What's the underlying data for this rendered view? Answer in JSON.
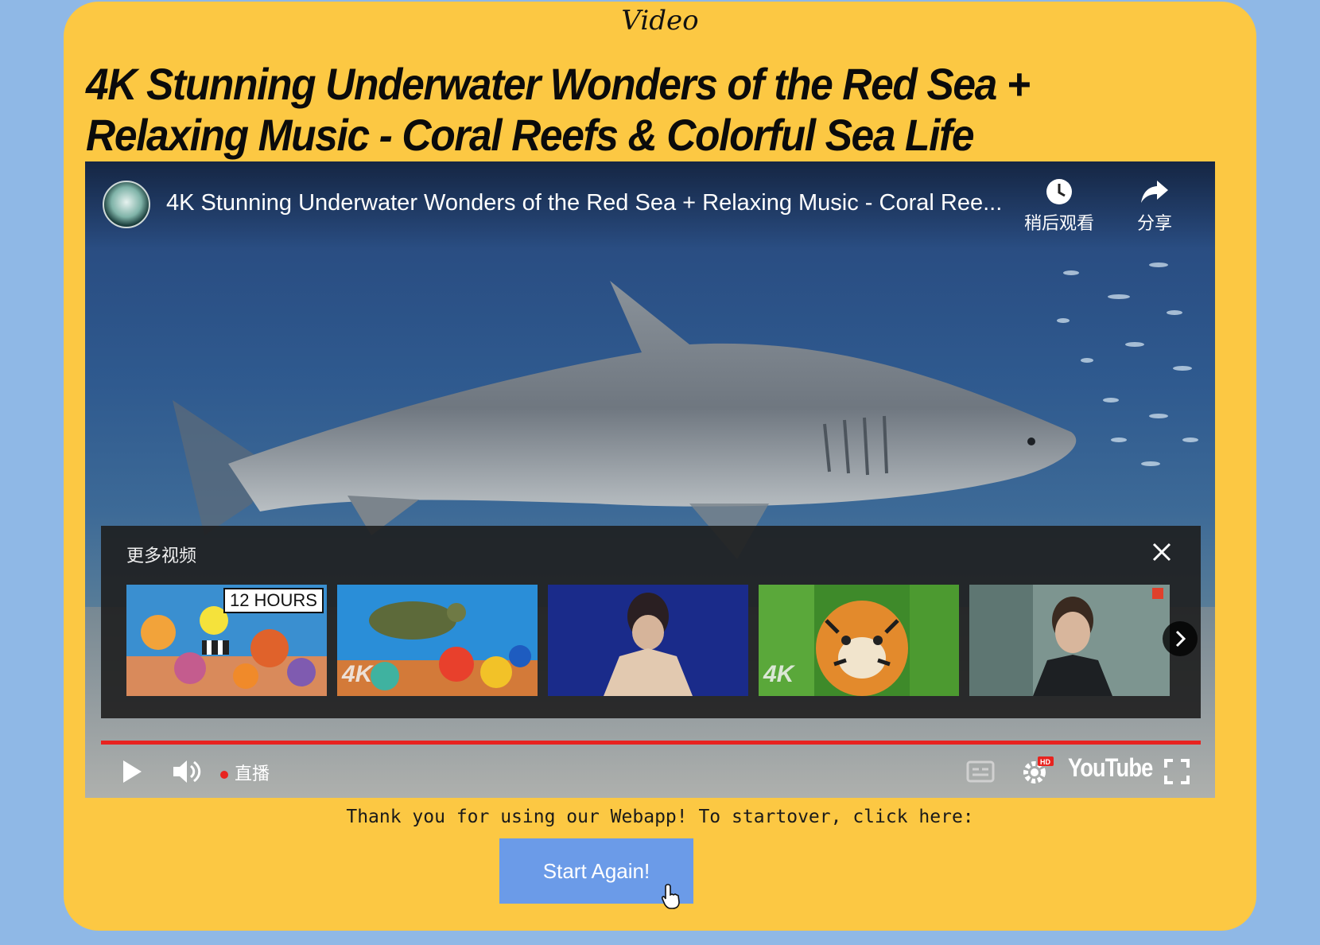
{
  "page": {
    "section_label": "Video",
    "video_title": "4K Stunning Underwater Wonders of the Red Sea + Relaxing Music - Coral Reefs & Colorful Sea Life"
  },
  "player": {
    "title": "4K Stunning Underwater Wonders of the Red Sea + Relaxing Music - Coral Ree...",
    "watch_later_label": "稍后观看",
    "share_label": "分享",
    "more_videos_label": "更多视频",
    "thumbnails": [
      {
        "badge": "12 HOURS",
        "overlay": ""
      },
      {
        "badge": "",
        "overlay": "4K"
      },
      {
        "badge": "",
        "overlay": ""
      },
      {
        "badge": "",
        "overlay": "4K"
      },
      {
        "badge": "",
        "overlay": ""
      }
    ],
    "live_label": "直播",
    "brand": "YouTube",
    "progress": 1.0,
    "icons": {
      "channel": "channel-avatar-icon",
      "watch_later": "clock-icon",
      "share": "share-arrow-icon",
      "close": "close-icon",
      "next": "chevron-right-icon",
      "play": "play-icon",
      "volume": "volume-icon",
      "subtitles": "subtitles-icon",
      "settings": "gear-icon",
      "fullscreen": "fullscreen-icon"
    }
  },
  "footer": {
    "thanks_text": "Thank you for using our Webapp! To startover, click here:",
    "button_label": "Start Again!"
  },
  "colors": {
    "page_bg": "#8fb8e6",
    "card_bg": "#fcc843",
    "button_bg": "#6b9be8",
    "progress": "#e8231f"
  }
}
